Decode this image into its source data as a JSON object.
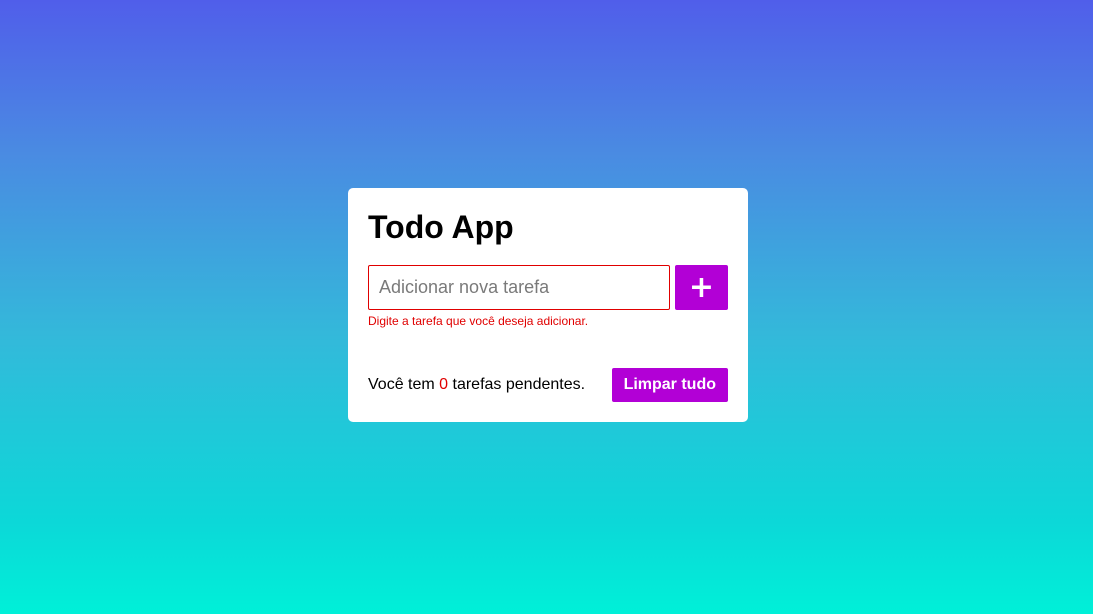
{
  "app": {
    "title": "Todo App"
  },
  "input": {
    "placeholder": "Adicionar nova tarefa",
    "value": "",
    "error": "Digite a tarefa que você deseja adicionar."
  },
  "add_button": {
    "label": "+",
    "icon": "plus-icon"
  },
  "footer": {
    "text_before": "Você tem ",
    "pending_count": "0",
    "text_after": " tarefas pendentes.",
    "clear_label": "Limpar tudo"
  },
  "colors": {
    "accent": "#b200d6",
    "error": "#e00000",
    "gradient_top": "#505eea",
    "gradient_bottom": "#00f0d8"
  }
}
